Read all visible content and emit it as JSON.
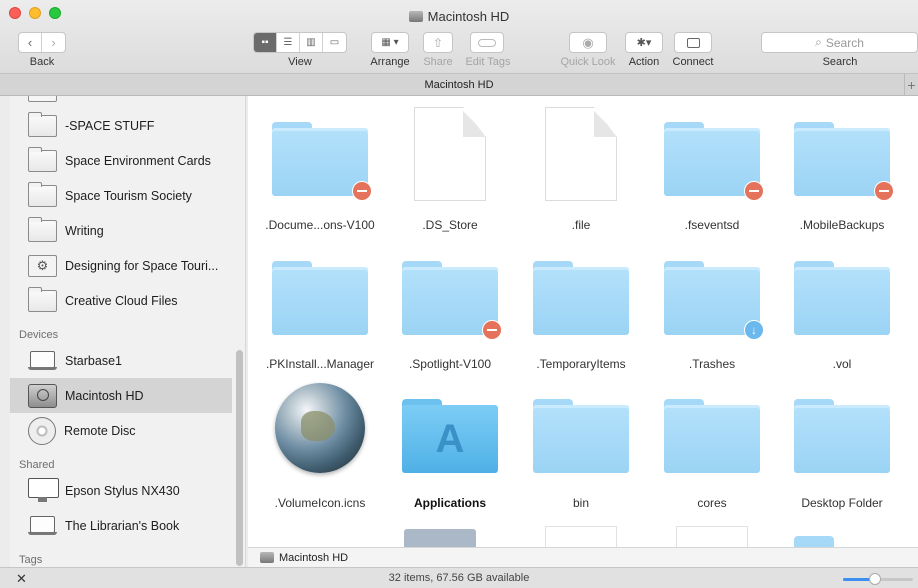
{
  "window": {
    "title": "Macintosh HD"
  },
  "toolbar": {
    "back_label": "Back",
    "view_label": "View",
    "arrange_label": "Arrange",
    "share_label": "Share",
    "edit_tags_label": "Edit Tags",
    "quick_look_label": "Quick Look",
    "action_label": "Action",
    "connect_label": "Connect",
    "search_label": "Search",
    "search_placeholder": "Search"
  },
  "tabbar": {
    "title": "Macintosh HD"
  },
  "sidebar": {
    "items": [
      {
        "label": "-SPACE STUFF",
        "icon": "folder-icon"
      },
      {
        "label": "Space Environment Cards",
        "icon": "folder-icon"
      },
      {
        "label": "Space Tourism Society",
        "icon": "folder-icon"
      },
      {
        "label": "Writing",
        "icon": "folder-icon"
      },
      {
        "label": "Designing for Space Touri...",
        "icon": "gear-folder-icon"
      },
      {
        "label": "Creative Cloud Files",
        "icon": "folder-icon"
      }
    ],
    "devices_header": "Devices",
    "devices": [
      {
        "label": "Starbase1",
        "icon": "laptop-icon"
      },
      {
        "label": "Macintosh HD",
        "icon": "hard-drive-icon",
        "selected": true
      },
      {
        "label": "Remote Disc",
        "icon": "disc-icon"
      }
    ],
    "shared_header": "Shared",
    "shared": [
      {
        "label": "Epson Stylus NX430",
        "icon": "monitor-icon"
      },
      {
        "label": "The Librarian's Book",
        "icon": "laptop-icon"
      }
    ],
    "tags_header": "Tags"
  },
  "files": [
    {
      "name": ".Docume...ons-V100",
      "kind": "folder",
      "badge": "restricted"
    },
    {
      "name": ".DS_Store",
      "kind": "document"
    },
    {
      "name": ".file",
      "kind": "document"
    },
    {
      "name": ".fseventsd",
      "kind": "folder",
      "badge": "restricted"
    },
    {
      "name": ".MobileBackups",
      "kind": "folder",
      "badge": "restricted"
    },
    {
      "name": ".PKInstall...Manager",
      "kind": "folder"
    },
    {
      "name": ".Spotlight-V100",
      "kind": "folder",
      "badge": "restricted"
    },
    {
      "name": ".TemporaryItems",
      "kind": "folder"
    },
    {
      "name": ".Trashes",
      "kind": "folder",
      "badge": "download"
    },
    {
      "name": ".vol",
      "kind": "folder"
    },
    {
      "name": ".VolumeIcon.icns",
      "kind": "globe"
    },
    {
      "name": "Applications",
      "kind": "app-folder"
    },
    {
      "name": "bin",
      "kind": "folder"
    },
    {
      "name": "cores",
      "kind": "folder"
    },
    {
      "name": "Desktop Folder",
      "kind": "folder"
    }
  ],
  "pathbar": {
    "label": "Macintosh HD"
  },
  "status": {
    "text": "32 items, 67.56 GB available",
    "icon_size_level": 0.45
  }
}
